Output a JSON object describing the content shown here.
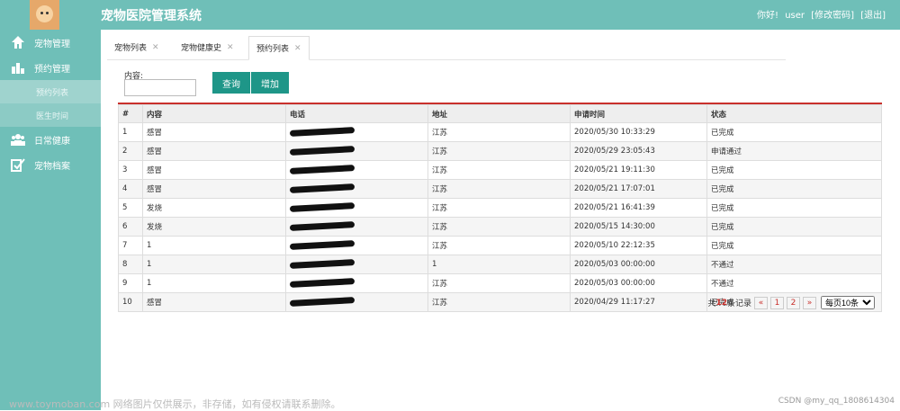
{
  "header": {
    "title": "宠物医院管理系统",
    "greeting": "你好!",
    "user": "user",
    "change_pwd": "[修改密码]",
    "logout": "[退出]"
  },
  "sidebar": {
    "items": [
      {
        "label": "宠物管理",
        "icon": "home-icon"
      },
      {
        "label": "预约管理",
        "icon": "chart-icon"
      },
      {
        "label": "日常健康",
        "icon": "people-icon"
      },
      {
        "label": "宠物档案",
        "icon": "check-icon"
      }
    ],
    "sub_items": [
      {
        "label": "预约列表"
      },
      {
        "label": "医生时间"
      }
    ]
  },
  "tabs": [
    {
      "label": "宠物列表"
    },
    {
      "label": "宠物健康史"
    },
    {
      "label": "预约列表"
    }
  ],
  "search": {
    "label": "内容:",
    "value": "",
    "query_button": "查询",
    "add_button": "增加"
  },
  "table": {
    "columns": [
      "#",
      "内容",
      "电话",
      "地址",
      "申请时间",
      "状态"
    ],
    "rows": [
      {
        "no": "1",
        "content": "感冒",
        "address": "江苏",
        "time": "2020/05/30 10:33:29",
        "status": "已完成"
      },
      {
        "no": "2",
        "content": "感冒",
        "address": "江苏",
        "time": "2020/05/29 23:05:43",
        "status": "申请通过"
      },
      {
        "no": "3",
        "content": "感冒",
        "address": "江苏",
        "time": "2020/05/21 19:11:30",
        "status": "已完成"
      },
      {
        "no": "4",
        "content": "感冒",
        "address": "江苏",
        "time": "2020/05/21 17:07:01",
        "status": "已完成"
      },
      {
        "no": "5",
        "content": "发烧",
        "address": "江苏",
        "time": "2020/05/21 16:41:39",
        "status": "已完成"
      },
      {
        "no": "6",
        "content": "发烧",
        "address": "江苏",
        "time": "2020/05/15 14:30:00",
        "status": "已完成"
      },
      {
        "no": "7",
        "content": "1",
        "address": "江苏",
        "time": "2020/05/10 22:12:35",
        "status": "已完成"
      },
      {
        "no": "8",
        "content": "1",
        "address": "1",
        "time": "2020/05/03 00:00:00",
        "status": "不通过"
      },
      {
        "no": "9",
        "content": "1",
        "address": "江苏",
        "time": "2020/05/03 00:00:00",
        "status": "不通过"
      },
      {
        "no": "10",
        "content": "感冒",
        "address": "江苏",
        "time": "2020/04/29 11:17:27",
        "status": "已完成"
      }
    ]
  },
  "pager": {
    "prefix": "共",
    "total": "12",
    "suffix": "条记录",
    "prev": "«",
    "page1": "1",
    "page2": "2",
    "next": "»",
    "per_page": "每页10条"
  },
  "footer": {
    "watermark": "www.toymoban.com 网络图片仅供展示，非存储，如有侵权请联系删除。",
    "credit": "CSDN @my_qq_1808614304"
  },
  "colors": {
    "theme": "#6fbfb8",
    "button": "#1e9688",
    "accent": "#c9302c"
  }
}
